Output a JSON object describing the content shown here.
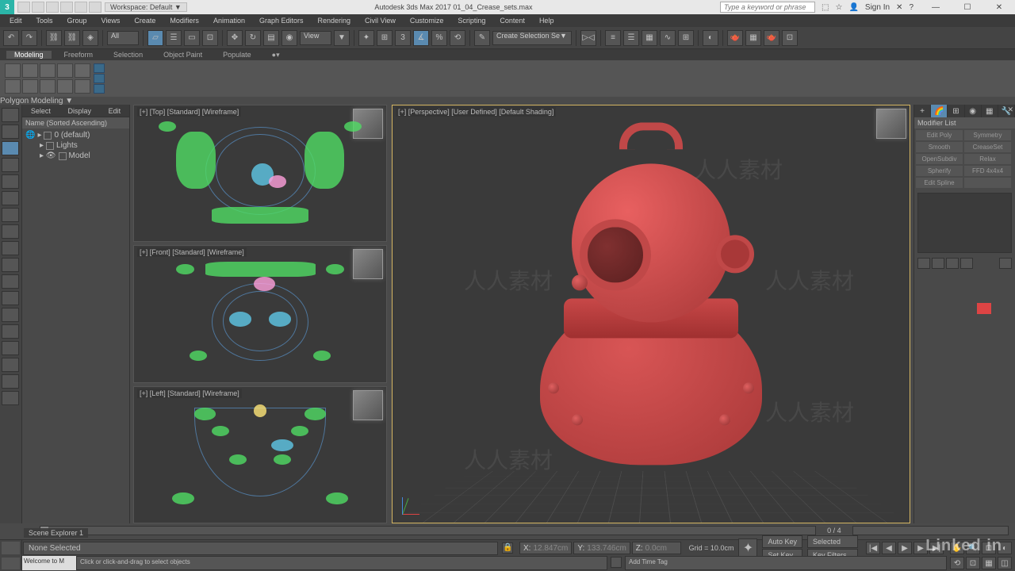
{
  "titlebar": {
    "app_letter": "3",
    "workspace": "Workspace: Default ▼",
    "title": "Autodesk 3ds Max 2017   01_04_Crease_sets.max",
    "search_placeholder": "Type a keyword or phrase",
    "sign_in": "Sign In",
    "min": "—",
    "max": "☐",
    "close": "✕"
  },
  "menu": [
    "Edit",
    "Tools",
    "Group",
    "Views",
    "Create",
    "Modifiers",
    "Animation",
    "Graph Editors",
    "Rendering",
    "Civil View",
    "Customize",
    "Scripting",
    "Content",
    "Help"
  ],
  "toolbar": {
    "all_filter": "All",
    "view": "View",
    "sel_set": "Create Selection Se▼"
  },
  "ribbon": {
    "tabs": [
      "Modeling",
      "Freeform",
      "Selection",
      "Object Paint",
      "Populate"
    ],
    "poly_label": "Polygon Modeling ▼"
  },
  "scene_explorer": {
    "top": [
      "Select",
      "Display",
      "Edit"
    ],
    "header": "Name (Sorted Ascending)",
    "nodes": [
      {
        "indent": 0,
        "label": "0 (default)"
      },
      {
        "indent": 1,
        "label": "Lights"
      },
      {
        "indent": 1,
        "label": "Model"
      }
    ],
    "bottom_label": "Scene Explorer 1"
  },
  "viewports": {
    "top": "[+] [Top] [Standard] [Wireframe]",
    "front": "[+] [Front] [Standard] [Wireframe]",
    "left": "[+] [Left] [Standard] [Wireframe]",
    "persp": "[+] [Perspective] [User Defined] [Default Shading]"
  },
  "right_panel": {
    "modifier_list": "Modifier List",
    "mods": [
      "Edit Poly",
      "Symmetry",
      "Smooth",
      "CreaseSet",
      "OpenSubdiv",
      "Relax",
      "Spherify",
      "FFD 4x4x4",
      "Edit Spline",
      ""
    ]
  },
  "timeline": {
    "frame": "0 / 4"
  },
  "status": {
    "selection": "None Selected",
    "welcome": "Welcome to M",
    "hint": "Click or click-and-drag to select objects",
    "x_lbl": "X:",
    "x_val": "12.847cm",
    "y_lbl": "Y:",
    "y_val": "133.746cm",
    "z_lbl": "Z:",
    "z_val": "0.0cm",
    "grid": "Grid = 10.0cm",
    "add_time": "Add Time Tag",
    "auto_key": "Auto Key",
    "set_key": "Set Key",
    "selected": "Selected",
    "key_filters": "Key Filters..."
  },
  "watermark_text": "人人素材"
}
